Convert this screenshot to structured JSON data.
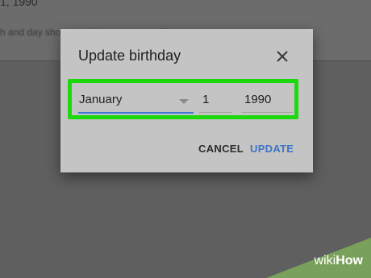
{
  "background": {
    "date_text": "1, 1990",
    "note_text": "h and day shown publicly on your profile, and more"
  },
  "dialog": {
    "title": "Update birthday",
    "close_icon": "close-icon",
    "month": {
      "value": "January"
    },
    "day": {
      "value": "1"
    },
    "year": {
      "value": "1990"
    },
    "cancel_label": "CANCEL",
    "update_label": "UPDATE"
  },
  "watermark": {
    "wiki": "wiki",
    "how": "How"
  },
  "colors": {
    "highlight": "#1bd90c",
    "accent": "#3e74c6",
    "dialog_bg": "#c4c4c4"
  }
}
